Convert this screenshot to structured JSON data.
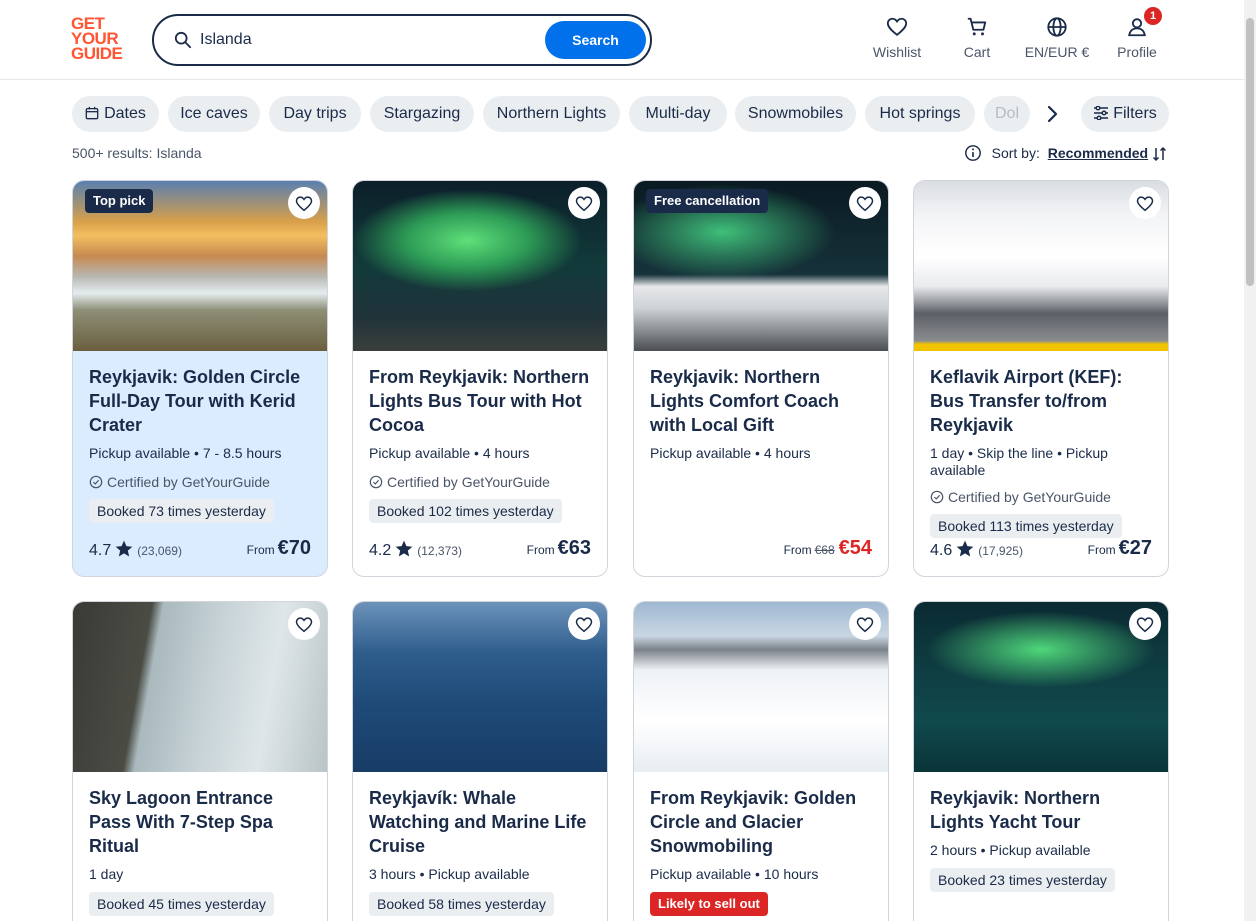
{
  "header": {
    "logo_lines": [
      "GET",
      "YOUR",
      "GUIDE"
    ],
    "search_value": "Islanda",
    "search_button": "Search",
    "nav": {
      "wishlist": "Wishlist",
      "cart": "Cart",
      "language": "EN/EUR €",
      "profile": "Profile",
      "profile_badge": "1"
    }
  },
  "chips": [
    "Dates",
    "Ice caves",
    "Day trips",
    "Stargazing",
    "Northern Lights",
    "Multi-day",
    "Snowmobiles",
    "Hot springs",
    "Dol"
  ],
  "filters_label": "Filters",
  "results_text": "500+ results: Islanda",
  "sort": {
    "label": "Sort by:",
    "value": "Recommended"
  },
  "colors": {
    "brand": "#ff5533",
    "accent": "#0071eb",
    "dark": "#1a2b49",
    "sale": "#dc2626"
  },
  "cards": [
    {
      "tag": "Top pick",
      "title": "Reykjavik: Golden Circle Full-Day Tour with Kerid Crater",
      "meta": "Pickup available • 7 - 8.5 hours",
      "certified": "Certified by GetYourGuide",
      "booked": "Booked 73 times yesterday",
      "rating": "4.7",
      "reviews": "(23,069)",
      "price_from": "From",
      "price": "€70"
    },
    {
      "title": "From Reykjavik: Northern Lights Bus Tour with Hot Cocoa",
      "meta": "Pickup available • 4 hours",
      "certified": "Certified by GetYourGuide",
      "booked": "Booked 102 times yesterday",
      "rating": "4.2",
      "reviews": "(12,373)",
      "price_from": "From",
      "price": "€63"
    },
    {
      "tag": "Free cancellation",
      "title": "Reykjavik: Northern Lights Comfort Coach with Local Gift",
      "meta": "Pickup available • 4 hours",
      "price_from": "From",
      "price_old": "€68",
      "price": "€54"
    },
    {
      "title": "Keflavik Airport (KEF): Bus Transfer to/from Reykjavik",
      "meta": "1 day • Skip the line • Pickup available",
      "certified": "Certified by GetYourGuide",
      "booked": "Booked 113 times yesterday",
      "rating": "4.6",
      "reviews": "(17,925)",
      "price_from": "From",
      "price": "€27"
    },
    {
      "title": "Sky Lagoon Entrance Pass With 7-Step Spa Ritual",
      "meta": "1 day",
      "booked": "Booked 45 times yesterday"
    },
    {
      "title": "Reykjavík: Whale Watching and Marine Life Cruise",
      "meta": "3 hours • Pickup available",
      "booked": "Booked 58 times yesterday"
    },
    {
      "title": "From Reykjavik: Golden Circle and Glacier Snowmobiling",
      "meta": "Pickup available • 10 hours",
      "sellout": "Likely to sell out"
    },
    {
      "title": "Reykjavik: Northern Lights Yacht Tour",
      "meta": "2 hours • Pickup available",
      "booked": "Booked 23 times yesterday"
    }
  ]
}
